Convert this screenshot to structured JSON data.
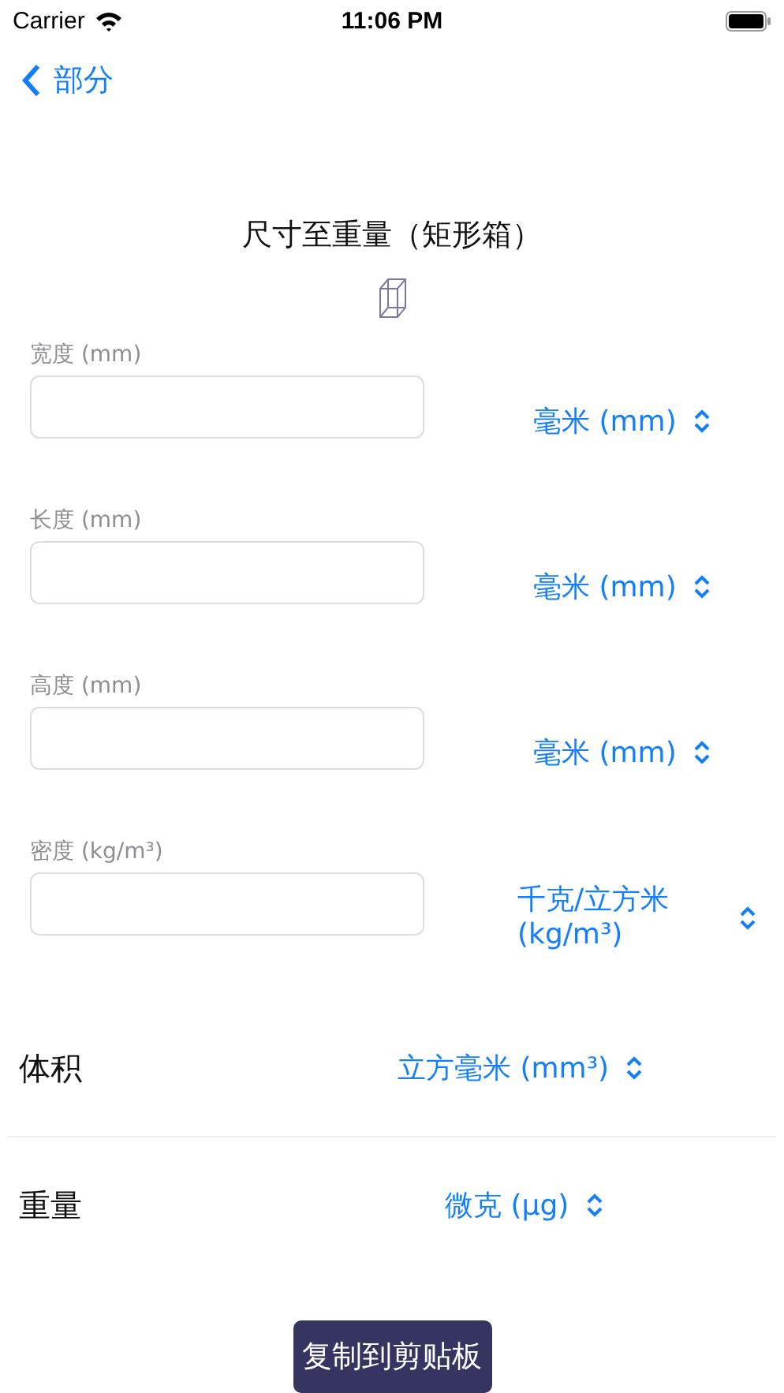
{
  "status_bar": {
    "carrier": "Carrier",
    "time": "11:06 PM"
  },
  "nav": {
    "back_label": "部分"
  },
  "title": "尺寸至重量（矩形箱）",
  "inputs": [
    {
      "label": "宽度 (mm)",
      "unit": "毫米 (mm)"
    },
    {
      "label": "长度 (mm)",
      "unit": "毫米 (mm)"
    },
    {
      "label": "高度 (mm)",
      "unit": "毫米 (mm)"
    },
    {
      "label": "密度 (kg/m³)",
      "unit": "千克/立方米 (kg/m³)"
    }
  ],
  "results": [
    {
      "label": "体积",
      "unit": "立方毫米 (mm³)"
    },
    {
      "label": "重量",
      "unit": "微克 (µg)"
    }
  ],
  "copy_button": "复制到剪贴板"
}
